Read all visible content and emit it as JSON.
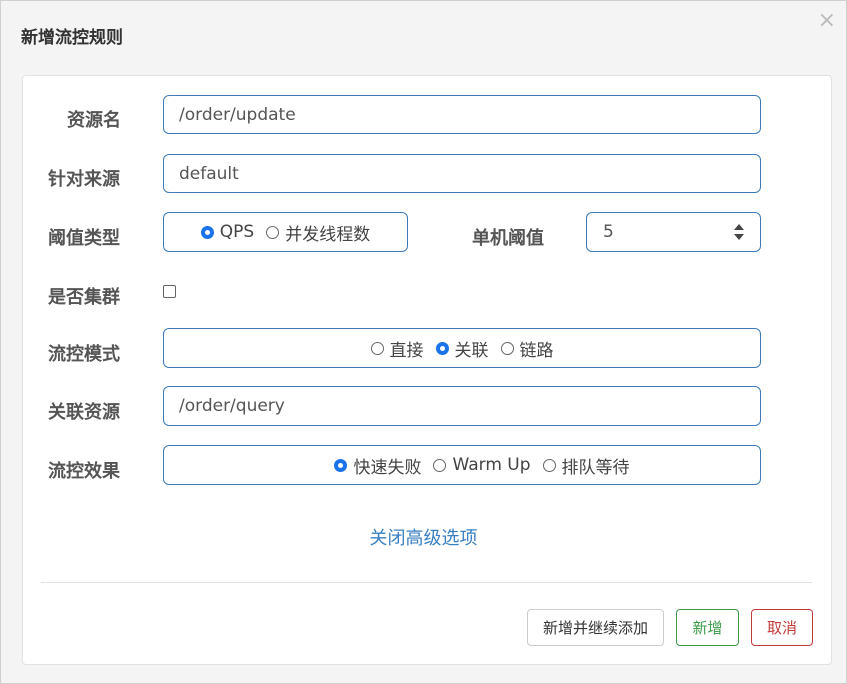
{
  "dialog": {
    "title": "新增流控规则",
    "close_symbol": "×"
  },
  "form": {
    "resource_name": {
      "label": "资源名",
      "value": "/order/update"
    },
    "limit_app": {
      "label": "针对来源",
      "value": "default"
    },
    "threshold_type": {
      "label": "阈值类型",
      "options": [
        "QPS",
        "并发线程数"
      ],
      "selected": "QPS"
    },
    "single_threshold": {
      "label": "单机阈值",
      "value": "5"
    },
    "cluster": {
      "label": "是否集群",
      "checked": false
    },
    "flow_mode": {
      "label": "流控模式",
      "options": [
        "直接",
        "关联",
        "链路"
      ],
      "selected": "关联"
    },
    "related_resource": {
      "label": "关联资源",
      "value": "/order/query"
    },
    "flow_effect": {
      "label": "流控效果",
      "options": [
        "快速失败",
        "Warm Up",
        "排队等待"
      ],
      "selected": "快速失败"
    }
  },
  "advanced_toggle": "关闭高级选项",
  "buttons": {
    "add_continue": "新增并继续添加",
    "add": "新增",
    "cancel": "取消"
  },
  "colors": {
    "accent": "#1a73e8",
    "border": "#3d7ab5",
    "link": "#3a7fc1",
    "add_green": "#3c9a4a",
    "cancel_red": "#c23b3b"
  }
}
